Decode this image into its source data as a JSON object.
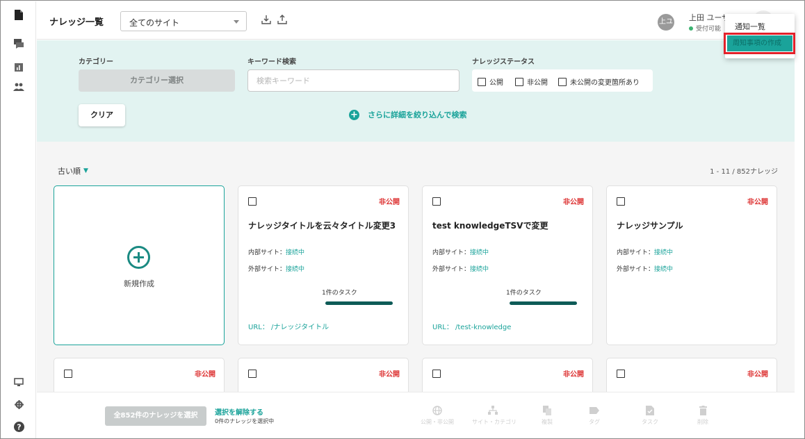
{
  "header": {
    "title": "ナレッジ一覧",
    "site_select": "全てのサイト",
    "user_initials": "上ユ",
    "user_name": "上田 ユーザ",
    "user_status": "受付可能"
  },
  "menu": {
    "item1": "通知一覧",
    "item2": "周知事項の作成"
  },
  "filter": {
    "category_label": "カテゴリー",
    "category_button": "カテゴリー選択",
    "keyword_label": "キーワード検索",
    "keyword_placeholder": "検索キーワード",
    "keyword_value": "",
    "status_label": "ナレッジステータス",
    "status_public": "公開",
    "status_private": "非公開",
    "status_unpublished_changes": "未公開の変更箇所あり",
    "clear_button": "クリア",
    "advanced_search": "さらに詳細を絞り込んで検索"
  },
  "list": {
    "sort": "古い順",
    "count": "1 - 11 / 852ナレッジ",
    "new_label": "新規作成",
    "cards": [
      {
        "status": "非公開",
        "title": "ナレッジタイトルを云々タイトル変更3",
        "internal_label": "内部サイト：",
        "internal_value": "接続中",
        "external_label": "外部サイト：",
        "external_value": "接続中",
        "task": "1件のタスク",
        "task_progress": 1.0,
        "url": "URL：  /ナレッジタイトル"
      },
      {
        "status": "非公開",
        "title": "test knowledgeTSVで変更",
        "internal_label": "内部サイト：",
        "internal_value": "接続中",
        "external_label": "外部サイト：",
        "external_value": "接続中",
        "task": "1件のタスク",
        "task_progress": 1.0,
        "url": "URL：  /test-knowledge"
      },
      {
        "status": "非公開",
        "title": "ナレッジサンプル",
        "internal_label": "内部サイト：",
        "internal_value": "接続中",
        "external_label": "外部サイト：",
        "external_value": "接続中"
      }
    ],
    "row2_status": [
      "非公開",
      "非公開",
      "非公開",
      "非公開"
    ]
  },
  "footer": {
    "select_all": "全852件のナレッジを選択",
    "deselect": "選択を解除する",
    "selected_count": "0件のナレッジを選択中",
    "actions": [
      "公開・非公開",
      "サイト・カテゴリ",
      "複製",
      "タグ",
      "タスク",
      "削除"
    ]
  },
  "colors": {
    "accent": "#1aa39a",
    "private": "#dd3333",
    "highlight": "#e3212a"
  }
}
